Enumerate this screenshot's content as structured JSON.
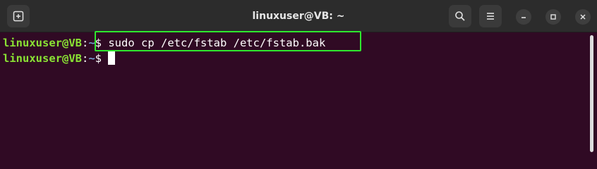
{
  "window": {
    "title": "linuxuser@VB: ~"
  },
  "toolbar": {
    "new_tab_icon": "new-tab-icon",
    "search_icon": "search-icon",
    "menu_icon": "hamburger-menu-icon",
    "minimize_icon": "minimize-icon",
    "maximize_icon": "maximize-icon",
    "close_icon": "close-icon"
  },
  "terminal": {
    "lines": [
      {
        "user_host": "linuxuser@VB",
        "separator": ":",
        "path": "~",
        "prompt": "$ ",
        "command": "sudo cp /etc/fstab /etc/fstab.bak"
      },
      {
        "user_host": "linuxuser@VB",
        "separator": ":",
        "path": "~",
        "prompt": "$ ",
        "command": ""
      }
    ]
  },
  "colors": {
    "background": "#300a24",
    "titlebar": "#2c2c2c",
    "user_host": "#8ae234",
    "path": "#729fcf",
    "highlight_border": "#2ee82e"
  }
}
